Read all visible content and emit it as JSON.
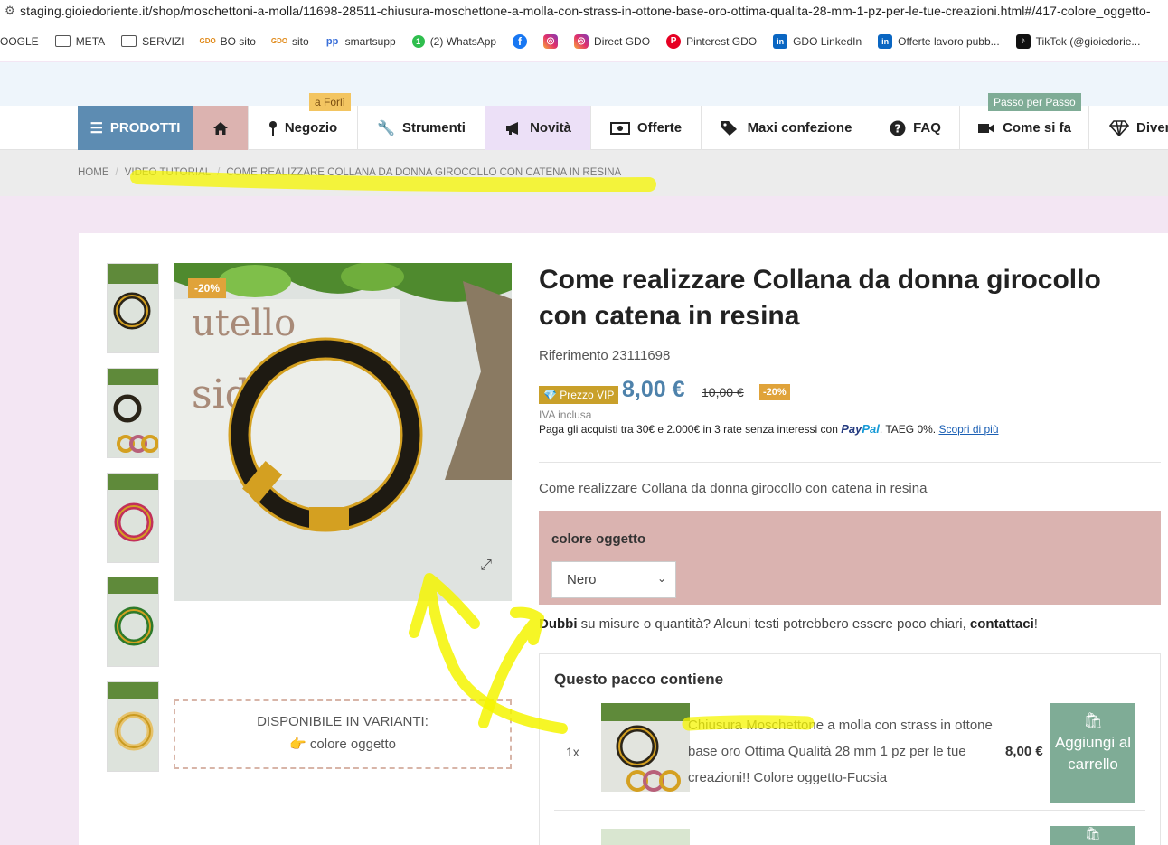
{
  "browser": {
    "url": "staging.gioiedoriente.it/shop/moschettoni-a-molla/11698-28511-chiusura-moschettone-a-molla-con-strass-in-ottone-base-oro-ottima-qualita-28-mm-1-pz-per-le-tue-creazioni.html#/417-colore_oggetto-"
  },
  "bookmarks": [
    {
      "label": "OOGLE",
      "icon": "none"
    },
    {
      "label": "META",
      "icon": "folder-icon"
    },
    {
      "label": "SERVIZI",
      "icon": "folder-icon"
    },
    {
      "label": "BO sito",
      "icon": "gdo-icon"
    },
    {
      "label": "sito",
      "icon": "gdo-icon"
    },
    {
      "label": "smartsupp",
      "icon": "smartsupp-icon"
    },
    {
      "label": "(2) WhatsApp",
      "icon": "whatsapp-icon"
    },
    {
      "label": "",
      "icon": "facebook-icon"
    },
    {
      "label": "",
      "icon": "instagram-icon"
    },
    {
      "label": "Direct GDO",
      "icon": "instagram-icon"
    },
    {
      "label": "Pinterest GDO",
      "icon": "pinterest-icon"
    },
    {
      "label": "GDO LinkedIn",
      "icon": "linkedin-icon"
    },
    {
      "label": "Offerte lavoro pubb...",
      "icon": "linkedin-icon"
    },
    {
      "label": "TikTok (@gioiedorie...",
      "icon": "tiktok-icon"
    }
  ],
  "nav": {
    "prodotti": "PRODOTTI",
    "negozio": "Negozio",
    "strumenti": "Strumenti",
    "novita": "Novità",
    "offerte": "Offerte",
    "maxi": "Maxi confezione",
    "faq": "FAQ",
    "comesifa": "Come si fa",
    "diver": "Diver",
    "badge_forli": "a Forlì",
    "badge_passo": "Passo per Passo"
  },
  "breadcrumb": {
    "home": "HOME",
    "tutorial": "VIDEO TUTORIAL",
    "current": "COME REALIZZARE COLLANA DA DONNA GIROCOLLO CON CATENA IN RESINA"
  },
  "product": {
    "discount_badge": "-20%",
    "title": "Come realizzare Collana da donna girocollo con catena in resina",
    "reference": "Riferimento 23111698",
    "vip_label": "Prezzo VIP",
    "price": "8,00 €",
    "old_price": "10,00 €",
    "discount_pct": "-20%",
    "tax": "IVA inclusa",
    "paypal_text": "Paga gli acquisti tra 30€ e 2.000€ in 3 rate senza interessi con",
    "paypal_brand_1": "Pay",
    "paypal_brand_2": "Pal",
    "paypal_taeg": ". TAEG 0%.",
    "paypal_link": "Scopri di più",
    "short_description": "Come realizzare Collana da donna girocollo con catena in resina",
    "option_label": "colore oggetto",
    "option_value": "Nero",
    "doubts_bold": "Dubbi",
    "doubts_text": " su misure o quantità? Alcuni testi potrebbero essere poco chiari, ",
    "doubts_link": "contattaci",
    "doubts_end": "!",
    "variants_title": "DISPONIBILE IN VARIANTI:",
    "variants_item": "colore oggetto"
  },
  "pack": {
    "title": "Questo pacco contiene",
    "items": [
      {
        "qty": "1x",
        "name": "Chiusura Moschettone a molla con strass in ottone base oro Ottima Qualità 28 mm 1 pz per le tue creazioni!! Colore oggetto-Fucsia",
        "price": "8,00 €",
        "button": "Aggiungi al carrello"
      }
    ]
  },
  "colors": {
    "prodotti_bg": "#5d8cb2",
    "home_bg": "#dcb3b0",
    "novita_bg": "#ece0f7",
    "option_bg": "#dab3b0",
    "accent_orange": "#e0a33a",
    "button_green": "#7fac96",
    "price_blue": "#4e82ab",
    "highlight_yellow": "#f5f500"
  }
}
